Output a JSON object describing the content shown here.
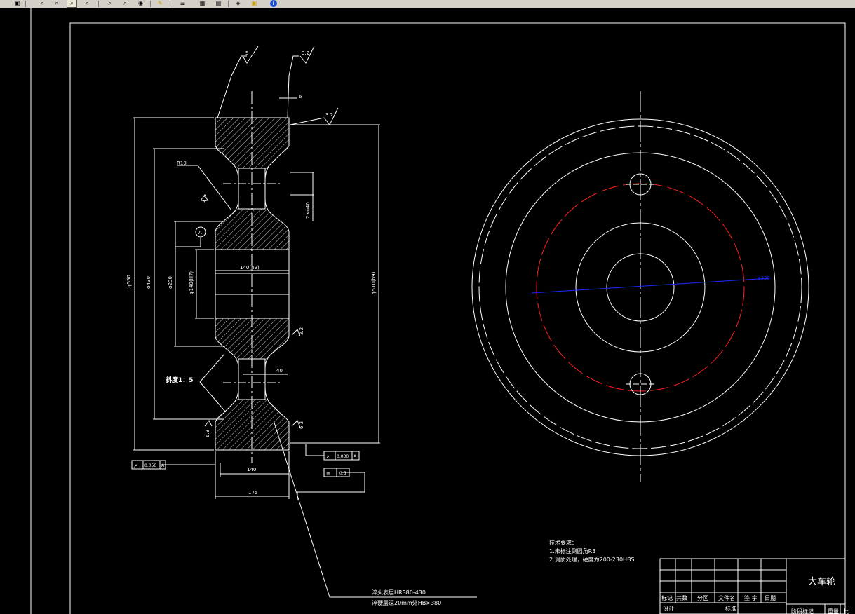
{
  "toolbar": {
    "icons": [
      "print-icon",
      "zoom-realtime-icon",
      "zoom-window-icon",
      "zoom-previous-icon",
      "zoom-extents-icon",
      "pan-icon",
      "zoom-in-icon",
      "zoom-out-icon",
      "layer-icon",
      "match-properties-icon",
      "properties-icon",
      "design-center-icon",
      "tool-palettes-icon",
      "markup-icon",
      "help-icon"
    ]
  },
  "drawing": {
    "dim_left": {
      "d550": "φ550",
      "d430": "φ430",
      "d230": "φ230",
      "d140": "φ140(H7)",
      "d510": "φ510(h9)",
      "w140": "140(h9)",
      "w140b": "140",
      "w175": "175",
      "hole": "2×φ40",
      "rad": "R10",
      "w40": "40",
      "taper": "斜度1：5"
    },
    "roughness": {
      "r5": "5",
      "r32a": "3.2",
      "r32b": "3.2",
      "r32c": "3.2",
      "r32d": "3.2",
      "r63a": "6.3",
      "r63b": "6.3",
      "angle": "6"
    },
    "tolerances": {
      "runout1": "0.050",
      "runout1_ref": "A",
      "runout2": "0.030",
      "runout2_ref": "A",
      "sym": "0.5",
      "datum": "A"
    },
    "notes": {
      "leader1": "淬火表层HRS80-430",
      "leader2": "淬硬层深20mm外HB>380"
    },
    "right_view": {
      "dim_label": "φ328"
    },
    "tech_req": {
      "title": "技术要求：",
      "line1": "1.未标注倒圆角R3",
      "line2": "2.调质处理，硬度为200-230HBS"
    },
    "title_block": {
      "part_name": "大车轮",
      "h_biaoji": "标记",
      "h_chushu": "共数",
      "h_fenqu": "分区",
      "h_wenjian": "文件名",
      "h_qianzi": "签 字",
      "h_riqi": "日期",
      "sheji": "设计",
      "biaozhun": "标准",
      "jieduan": "阶段标记",
      "zhongliang": "重量",
      "bili": "比"
    }
  }
}
